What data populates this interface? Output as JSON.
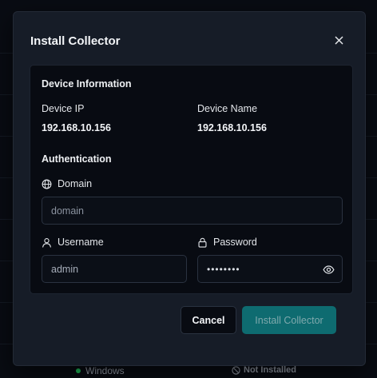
{
  "background": {
    "os_label": "Windows",
    "status_label": "Not Installed"
  },
  "modal": {
    "title": "Install Collector",
    "close_icon": "close-icon",
    "device_info": {
      "heading": "Device Information",
      "ip_label": "Device IP",
      "ip_value": "192.168.10.156",
      "name_label": "Device Name",
      "name_value": "192.168.10.156"
    },
    "auth": {
      "heading": "Authentication",
      "domain_label": "Domain",
      "domain_icon": "globe-icon",
      "domain_placeholder": "domain",
      "username_label": "Username",
      "username_icon": "user-icon",
      "username_value": "admin",
      "password_label": "Password",
      "password_icon": "lock-icon",
      "password_value": "••••••••",
      "toggle_icon": "eye-icon"
    },
    "buttons": {
      "cancel": "Cancel",
      "install": "Install Collector"
    }
  },
  "colors": {
    "accent": "#0e6b70",
    "status_green": "#22c55e",
    "panel_bg": "#080b12",
    "modal_bg": "#161c27"
  }
}
